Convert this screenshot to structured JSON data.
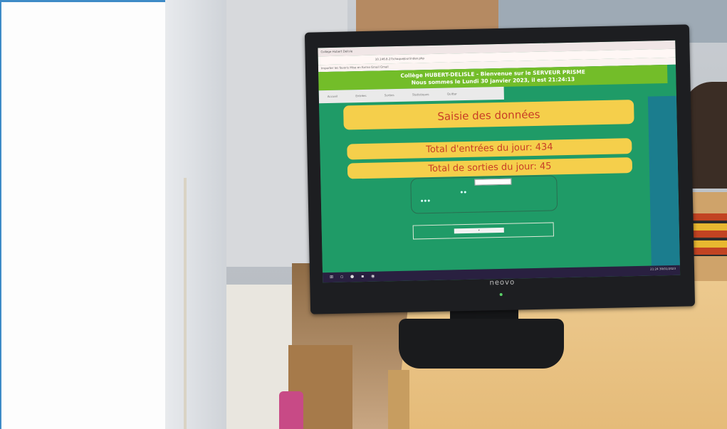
{
  "browser": {
    "tab_title": "Collège Hubert Delisle",
    "url": "10.146.8.27/chaqueJour/index.php",
    "bookmarks": "Importer les favoris   Mise en forme   Gmail   Gmail"
  },
  "header": {
    "line1": "Collège HUBERT-DELISLE - Bienvenue sur le SERVEUR PRISME",
    "line2": "Nous sommes le Lundi 30 janvier 2023, il est 21:24:13"
  },
  "nav": {
    "items": [
      "Accueil",
      "Entrées",
      "Sorties",
      "Statistiques",
      "Quitter"
    ]
  },
  "main": {
    "title": "Saisie des données",
    "total_entrees": "Total d'entrées du jour: 434",
    "total_sorties": "Total de sorties du jour: 45"
  },
  "monitor": {
    "brand": "neovo"
  },
  "taskbar": {
    "clock": "21:24 30/01/2023"
  }
}
